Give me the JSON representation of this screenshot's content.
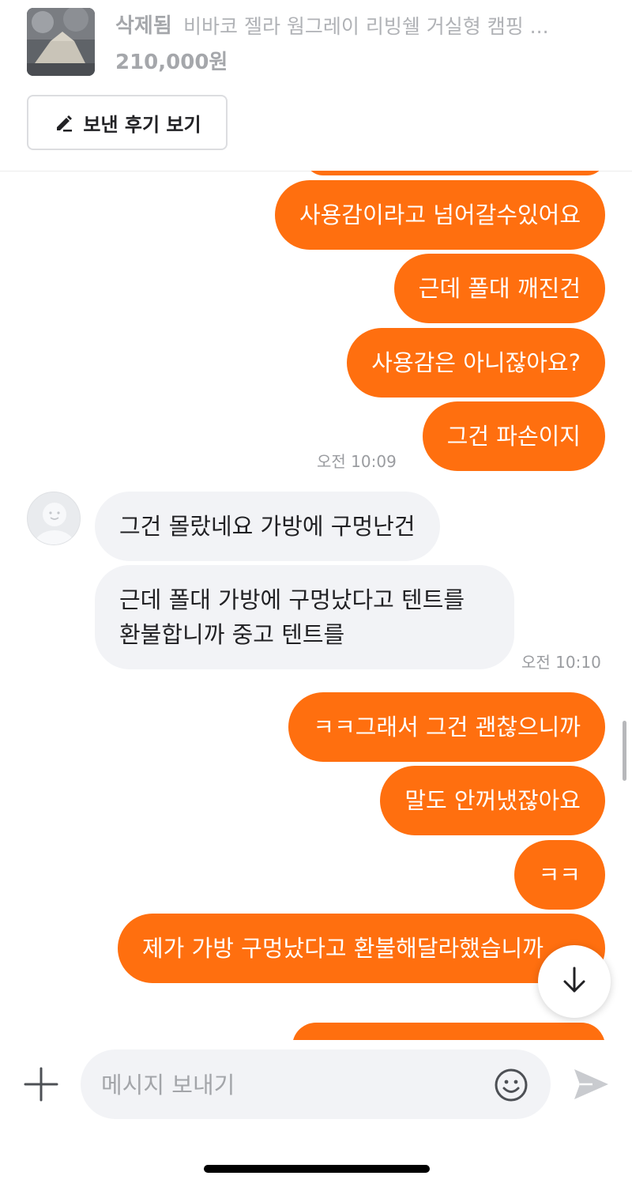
{
  "header": {
    "status": "삭제됨",
    "title": "비바코 젤라 웜그레이 리빙쉘 거실형 캠핑 ...",
    "price": "210,000원",
    "review_button": "보낸 후기 보기"
  },
  "messages": [
    {
      "side": "mine",
      "text": "사용감이라고 넘어갈수있어요"
    },
    {
      "side": "mine",
      "text": "근데 폴대 깨진건"
    },
    {
      "side": "mine",
      "text": "사용감은 아니잖아요?"
    },
    {
      "side": "mine",
      "text": "그건 파손이지"
    },
    {
      "side": "time",
      "text": "오전 10:09"
    },
    {
      "side": "theirs",
      "text": "그건 몰랐네요 가방에 구멍난건"
    },
    {
      "side": "theirs",
      "text": "근데 폴대 가방에 구멍났다고 텐트를 환불합니까 중고 텐트를"
    },
    {
      "side": "time",
      "text": "오전 10:10"
    },
    {
      "side": "mine",
      "text": "ㅋㅋ그래서 그건 괜찮으니까"
    },
    {
      "side": "mine",
      "text": "말도 안꺼냈잖아요"
    },
    {
      "side": "mine",
      "text": "ㅋㅋ"
    },
    {
      "side": "mine",
      "text": "제가 가방 구멍났다고 환불해달라했습니까"
    }
  ],
  "composer": {
    "placeholder": "메시지 보내기"
  },
  "icons": {
    "review": "pencil-icon",
    "attach": "plus-icon",
    "emoji": "smile-icon",
    "send": "send-icon",
    "scroll_down": "arrow-down-icon"
  },
  "colors": {
    "accent": "#ff6f0f",
    "their_bubble": "#f2f3f6"
  }
}
